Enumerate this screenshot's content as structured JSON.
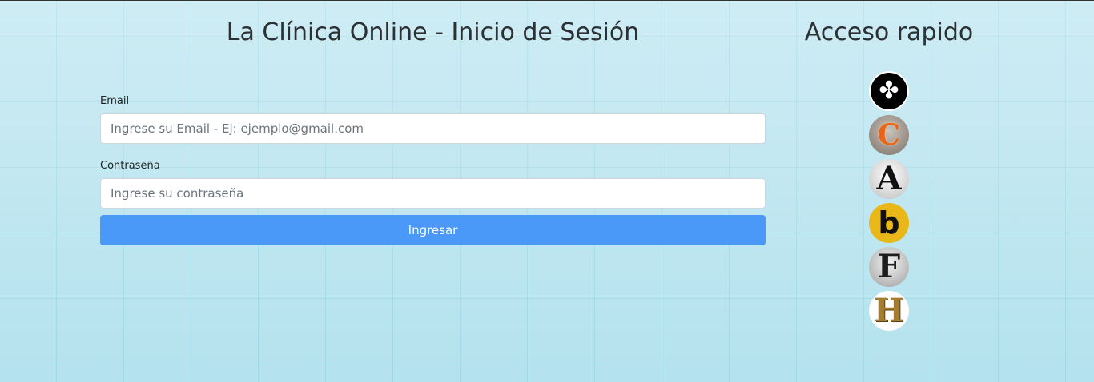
{
  "header": {
    "title": "La Clínica Online - Inicio de Sesión"
  },
  "login_form": {
    "email_label": "Email",
    "email_placeholder": "Ingrese su Email - Ej: ejemplo@gmail.com",
    "email_value": "",
    "password_label": "Contraseña",
    "password_placeholder": "Ingrese su contraseña",
    "password_value": "",
    "submit_label": "Ingresar",
    "submit_color": "#4a98f7"
  },
  "quick_access": {
    "title": "Acceso rapido",
    "items": [
      {
        "icon": "ornament-icon",
        "glyph": "✤"
      },
      {
        "icon": "marquee-letter-c-icon",
        "glyph": "C"
      },
      {
        "icon": "letter-a-icon",
        "glyph": "A"
      },
      {
        "icon": "letter-b-icon",
        "glyph": "b"
      },
      {
        "icon": "letter-f-icon",
        "glyph": "F"
      },
      {
        "icon": "letter-h-icon",
        "glyph": "H"
      }
    ]
  }
}
